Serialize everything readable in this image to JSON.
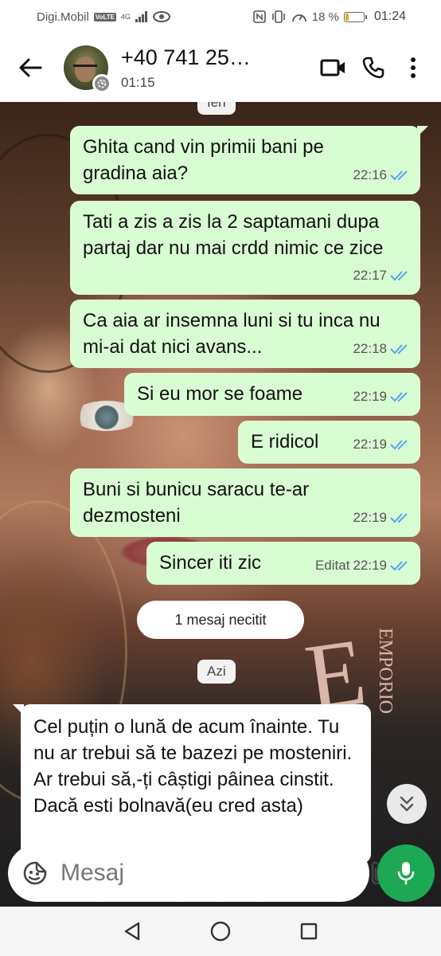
{
  "status_bar": {
    "carrier": "Digi.Mobil",
    "volte": "VoLTE",
    "network": "4G",
    "battery": "18 %",
    "battery_level": 0.18,
    "time": "01:24"
  },
  "header": {
    "contact_name": "+40 741 25…",
    "status": "01:15"
  },
  "chat": {
    "top_chip": "Ieri",
    "messages": [
      {
        "text": "Ghita cand vin primii bani pe gradina aia?",
        "time": "22:16"
      },
      {
        "text": "Tati a zis a zis la 2 saptamani dupa partaj dar nu mai crdd nimic ce zice",
        "time": "22:17"
      },
      {
        "text": "Ca aia ar insemna luni si tu inca nu mi-ai dat nici avans...",
        "time": "22:18"
      },
      {
        "text": "Si eu mor se foame",
        "time": "22:19"
      },
      {
        "text": "E ridicol",
        "time": "22:19"
      },
      {
        "text": "Buni si bunicu saracu te-ar dezmosteni",
        "time": "22:19"
      },
      {
        "text": "Sincer iti zic",
        "time": "22:19",
        "edited": "Editat"
      }
    ],
    "unread_label": "1 mesaj necitit",
    "today_chip": "Azi",
    "incoming": {
      "text": "Cel puțin o lună de acum înainte. Tu nu ar trebui să te bazezi pe mosteniri. Ar trebui să,-ți câștigi pâinea cinstit. Dacă esti bolnavă(eu cred asta)"
    },
    "background_logo": "EMPORIO"
  },
  "input": {
    "placeholder": "Mesaj"
  },
  "icons": {
    "back": "arrow-left-icon",
    "video": "video-call-icon",
    "call": "phone-icon",
    "menu": "more-vert-icon",
    "emoji": "sticker-icon",
    "attach": "paperclip-icon",
    "camera": "camera-icon",
    "mic": "microphone-icon",
    "scroll": "chevrons-down-icon"
  },
  "colors": {
    "outgoing_bubble": "#d9fdd3",
    "incoming_bubble": "#ffffff",
    "tick_read": "#53a6f0",
    "mic_button": "#1da856"
  }
}
